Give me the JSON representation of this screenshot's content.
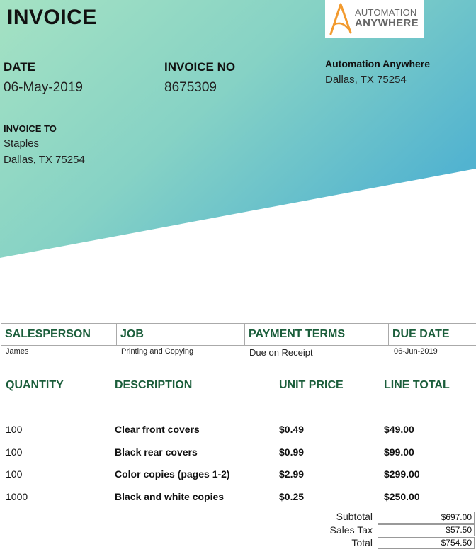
{
  "title": "INVOICE",
  "date": {
    "label": "DATE",
    "value": "06-May-2019"
  },
  "invoice_no": {
    "label": "INVOICE NO",
    "value": "8675309"
  },
  "company": {
    "name": "Automation Anywhere",
    "address": "Dallas, TX 75254"
  },
  "logo": {
    "line1": "AUTOMATION",
    "line2": "ANYWHERE",
    "accent": "#f29a2e"
  },
  "invoice_to": {
    "label": "INVOICE TO",
    "name": "Staples",
    "address": "Dallas, TX 75254"
  },
  "info_table": {
    "headers": [
      "SALESPERSON",
      "JOB",
      "PAYMENT TERMS",
      "DUE DATE"
    ],
    "values": [
      "James",
      "Printing and Copying",
      "Due on Receipt",
      "06-Jun-2019"
    ]
  },
  "items_header": [
    "QUANTITY",
    "DESCRIPTION",
    "UNIT PRICE",
    "LINE TOTAL"
  ],
  "items": [
    {
      "qty": "100",
      "desc": "Clear front covers",
      "price": "$0.49",
      "total": "$49.00"
    },
    {
      "qty": "100",
      "desc": "Black rear covers",
      "price": "$0.99",
      "total": "$99.00"
    },
    {
      "qty": "100",
      "desc": "Color copies (pages 1-2)",
      "price": "$2.99",
      "total": "$299.00"
    },
    {
      "qty": "1000",
      "desc": "Black and white copies",
      "price": "$0.25",
      "total": "$250.00"
    }
  ],
  "totals": {
    "subtotal_label": "Subtotal",
    "subtotal": "$697.00",
    "tax_label": "Sales Tax",
    "tax": "$57.50",
    "total_label": "Total",
    "total": "$754.50"
  },
  "colors": {
    "gradient_start": "#9ee0c2",
    "gradient_end": "#56b6cf",
    "header_green": "#1b5e3b"
  }
}
